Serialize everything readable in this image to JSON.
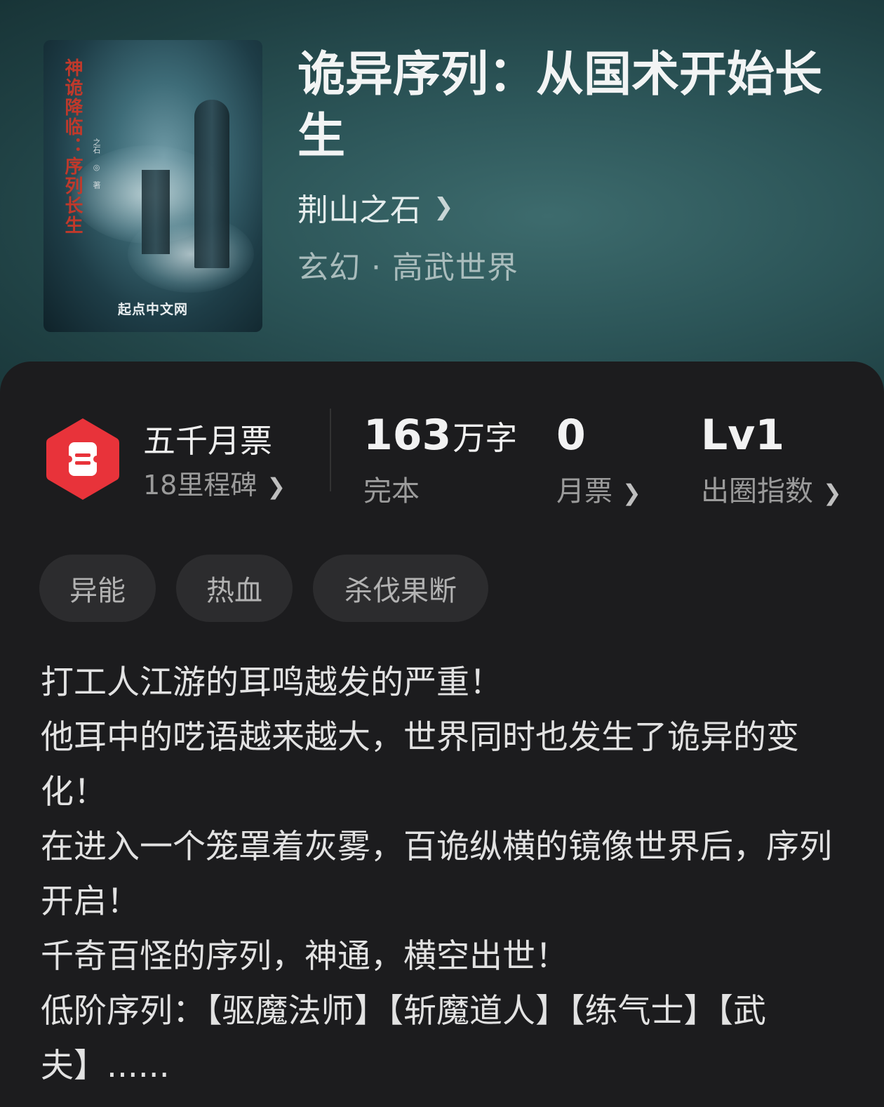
{
  "book": {
    "title": "诡异序列：从国术开始长生",
    "author": "荆山之石",
    "genre": "玄幻 · 高武世界",
    "cover": {
      "title": "神诡降临：序列长生",
      "author": "之石 ◎ 著",
      "brand": "起点中文网"
    }
  },
  "stats": {
    "milestone_title": "五千月票",
    "milestone_sub": "18里程碑",
    "words_value": "163",
    "words_unit": "万字",
    "words_label": "完本",
    "monthly_tickets_value": "0",
    "monthly_tickets_label": "月票",
    "popularity_value": "Lv1",
    "popularity_label": "出圈指数"
  },
  "tags": [
    "异能",
    "热血",
    "杀伐果断"
  ],
  "description": [
    "打工人江游的耳鸣越发的严重！",
    "他耳中的呓语越来越大，世界同时也发生了诡异的变化！",
    "在进入一个笼罩着灰雾，百诡纵横的镜像世界后，序列开启！",
    "千奇百怪的序列，神通，横空出世！",
    "低阶序列：【驱魔法师】【斩魔道人】【练气士】【武夫】......"
  ],
  "colors": {
    "hero_bg": "#2c5558",
    "panel_bg": "#1c1c1e",
    "badge_red": "#e8333a",
    "tag_bg": "#2c2c2e"
  },
  "icons": {
    "chevron": "chevron-right-icon",
    "badge": "ticket-hexagon-icon"
  }
}
